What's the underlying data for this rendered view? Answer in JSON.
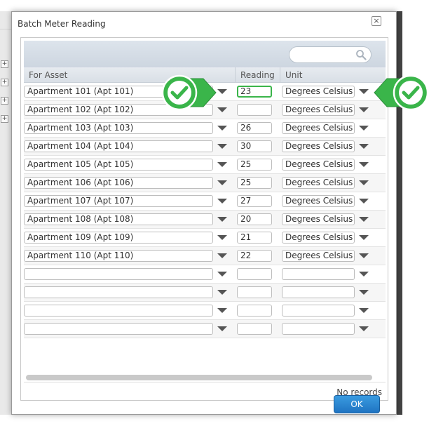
{
  "dialog": {
    "title": "Batch Meter Reading",
    "close_symbol": "×",
    "ok_label": "OK",
    "no_records": "No records"
  },
  "columns": {
    "asset": "For Asset",
    "reading": "Reading",
    "unit": "Unit"
  },
  "search": {
    "placeholder": ""
  },
  "rows": [
    {
      "asset": "Apartment 101 (Apt 101)",
      "reading": "23",
      "unit": "Degrees Celsius (C)"
    },
    {
      "asset": "Apartment 102 (Apt 102)",
      "reading": "",
      "unit": "Degrees Celsius (C)"
    },
    {
      "asset": "Apartment 103 (Apt 103)",
      "reading": "26",
      "unit": "Degrees Celsius (C)"
    },
    {
      "asset": "Apartment 104 (Apt 104)",
      "reading": "30",
      "unit": "Degrees Celsius (C)"
    },
    {
      "asset": "Apartment 105 (Apt 105)",
      "reading": "25",
      "unit": "Degrees Celsius (C)"
    },
    {
      "asset": "Apartment 106 (Apt 106)",
      "reading": "25",
      "unit": "Degrees Celsius (C)"
    },
    {
      "asset": "Apartment 107 (Apt 107)",
      "reading": "27",
      "unit": "Degrees Celsius (C)"
    },
    {
      "asset": "Apartment 108 (Apt 108)",
      "reading": "20",
      "unit": "Degrees Celsius (C)"
    },
    {
      "asset": "Apartment 109 (Apt 109)",
      "reading": "21",
      "unit": "Degrees Celsius (C)"
    },
    {
      "asset": "Apartment 110 (Apt 110)",
      "reading": "22",
      "unit": "Degrees Celsius (C)"
    },
    {
      "asset": "",
      "reading": "",
      "unit": ""
    },
    {
      "asset": "",
      "reading": "",
      "unit": ""
    },
    {
      "asset": "",
      "reading": "",
      "unit": ""
    },
    {
      "asset": "",
      "reading": "",
      "unit": ""
    }
  ],
  "colors": {
    "accent_green": "#3ab54a",
    "ok_blue": "#1f74c2"
  },
  "icons": [
    "search-icon",
    "close-icon",
    "chevron-down-icon",
    "checkmark-icon"
  ]
}
